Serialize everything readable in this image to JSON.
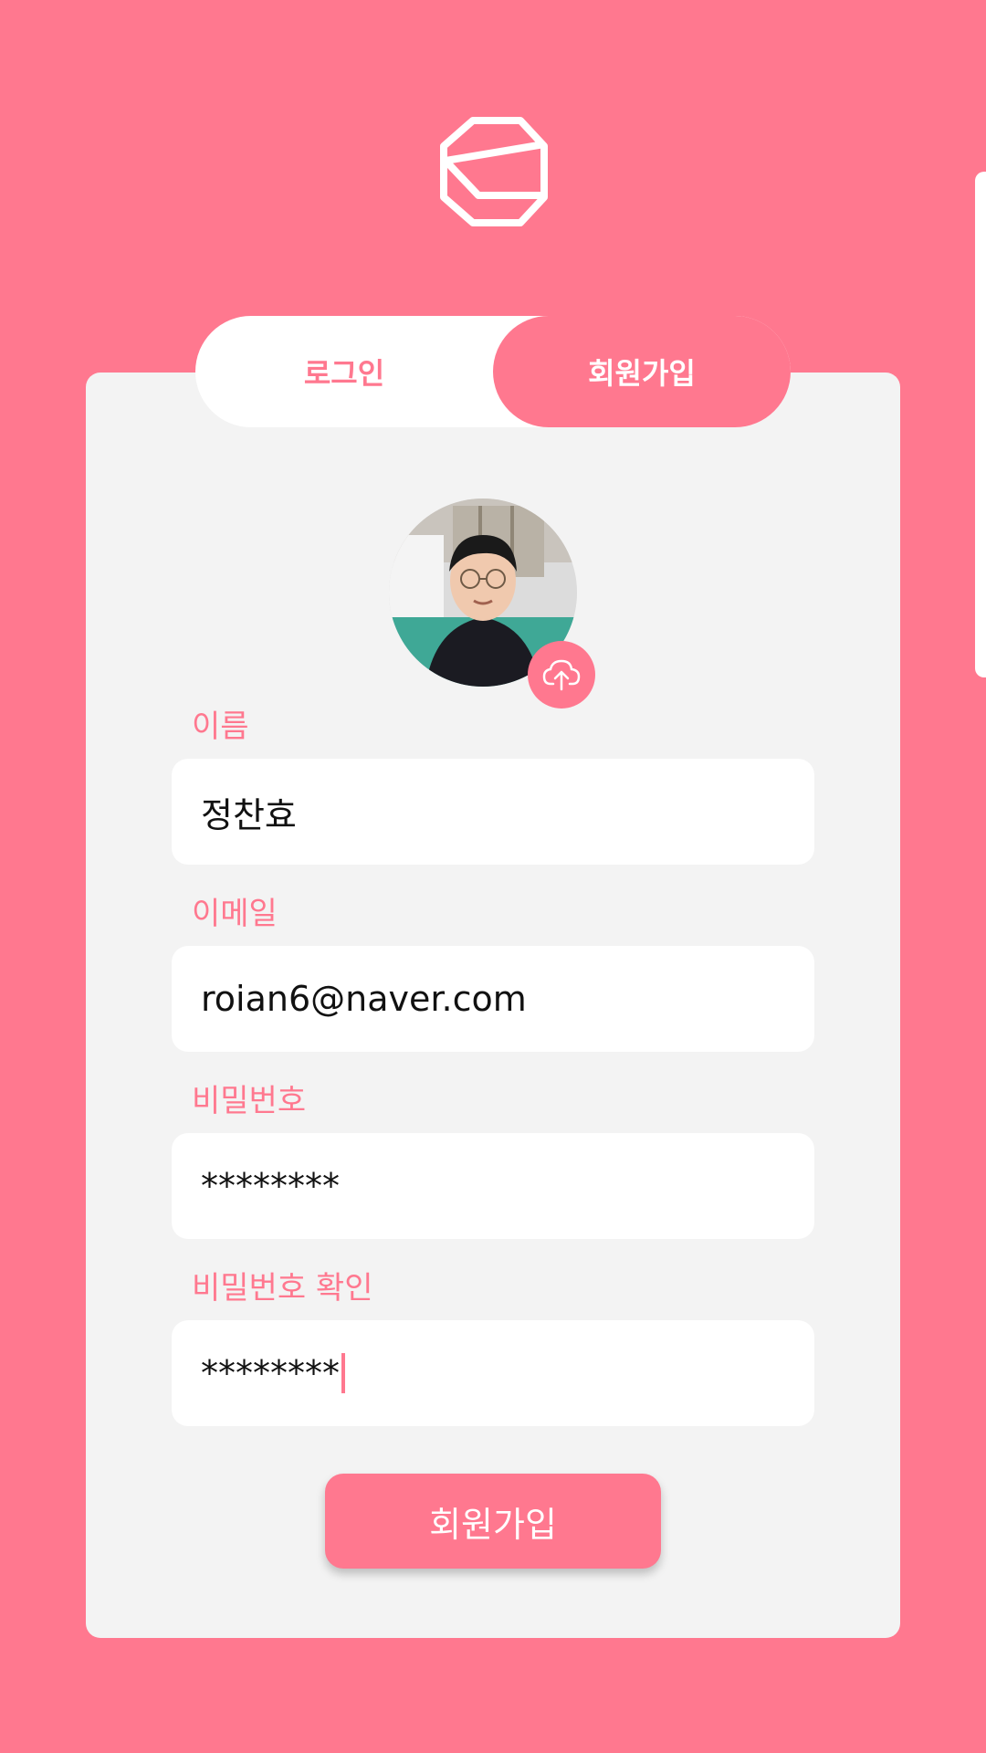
{
  "brand": {
    "logo_icon": "hexagon-logo-icon",
    "accent_color": "#ff788f",
    "background_color": "#ff788f"
  },
  "tabs": [
    {
      "label": "로그인",
      "active": false
    },
    {
      "label": "회원가입",
      "active": true
    }
  ],
  "profile": {
    "avatar_icon": "profile-photo",
    "upload_icon": "cloud-upload-icon"
  },
  "form": {
    "name": {
      "label": "이름",
      "value": "정찬효"
    },
    "email": {
      "label": "이메일",
      "value": "roian6@naver.com"
    },
    "password": {
      "label": "비밀번호",
      "value": "********"
    },
    "password_confirm": {
      "label": "비밀번호 확인",
      "value": "********"
    }
  },
  "submit_label": "회원가입"
}
